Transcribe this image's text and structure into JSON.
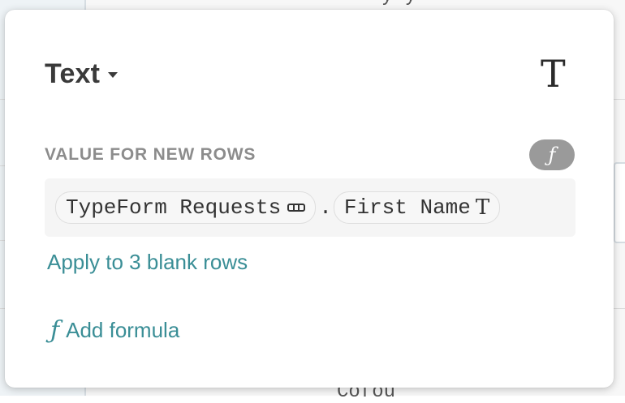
{
  "background": {
    "top_cell_text": "y y",
    "bottom_cell_text": "Cofoú"
  },
  "popover": {
    "type_selector": {
      "label": "Text",
      "type_glyph": "T",
      "caret_icon": "caret-down-icon"
    },
    "value_section": {
      "label": "VALUE FOR NEW ROWS",
      "formula_toggle_glyph": "ƒ",
      "formula": {
        "table_chip": "TypeForm Requests",
        "table_icon": "table-icon",
        "separator": ".",
        "field_chip": "First Name",
        "field_type_glyph": "T"
      }
    },
    "apply_link": "Apply to 3 blank rows",
    "add_formula": {
      "icon_glyph": "ƒ",
      "label": "Add formula"
    }
  },
  "colors": {
    "accent": "#3a8e96",
    "muted_label": "#8c8c8c",
    "toggle_bg": "#9a9a9a"
  }
}
